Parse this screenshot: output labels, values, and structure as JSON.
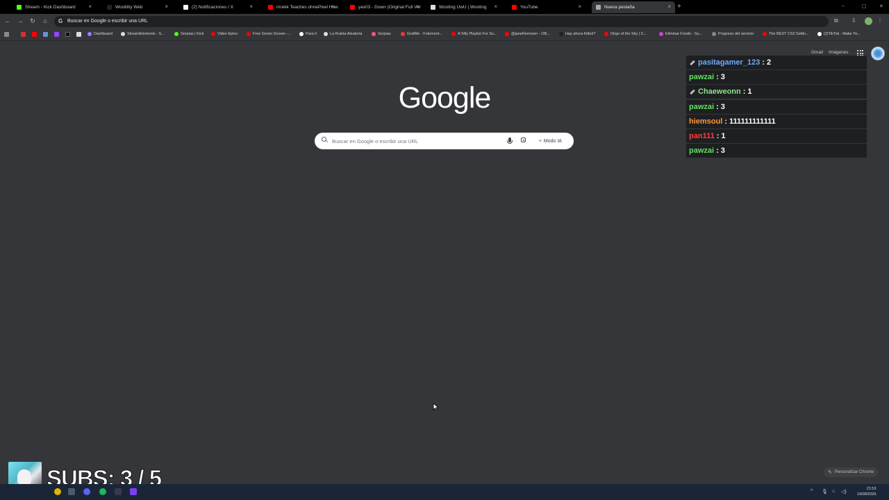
{
  "tabs": [
    {
      "title": "Stream - Kick Dashboard",
      "favicon_color": "#53fc18",
      "active": false
    },
    {
      "title": "Wootility Web",
      "favicon_color": "#222222",
      "active": false
    },
    {
      "title": "(2) Notificaciones / X",
      "favicon_color": "#ffffff",
      "active": false
    },
    {
      "title": "mrekk Teaches ohnePixel How t",
      "favicon_color": "#ff0000",
      "active": false
    },
    {
      "title": "yax03 - Down (Original Full Ver",
      "favicon_color": "#ff0000",
      "active": false
    },
    {
      "title": "Wooting UwU | Wooting",
      "favicon_color": "#dddddd",
      "active": false
    },
    {
      "title": "YouTube",
      "favicon_color": "#ff0000",
      "active": false
    },
    {
      "title": "Nueva pestaña",
      "favicon_color": "#aaaaaa",
      "active": true
    }
  ],
  "new_tab_label": "+",
  "omnibox": {
    "text": "Buscar en Google o escribir una URL"
  },
  "bookmarks": [
    {
      "label": "",
      "color": "#9b7bff"
    },
    {
      "label": "Dashboard",
      "color": "#9b7bff"
    },
    {
      "label": "StreamElements - S...",
      "color": "#dddddd"
    },
    {
      "label": "Serpias | Kick",
      "color": "#53fc18"
    },
    {
      "label": "Video Epico",
      "color": "#ff0000"
    },
    {
      "label": "Free Green Screen -...",
      "color": "#ff0000"
    },
    {
      "label": "Para ti",
      "color": "#ffffff"
    },
    {
      "label": "La Ruleta Aleatoria",
      "color": "#dddddd"
    },
    {
      "label": "Serpias",
      "color": "#ff5577"
    },
    {
      "label": "GrafMe - Fotomont...",
      "color": "#ff3333"
    },
    {
      "label": "A Silly Playlist For Su...",
      "color": "#ff0000"
    },
    {
      "label": "@janeRemover - OB...",
      "color": "#ff0000"
    },
    {
      "label": "Hay ahora fútbol?",
      "color": "#222222"
    },
    {
      "label": "Dirge of the Sky | C...",
      "color": "#ff0000"
    },
    {
      "label": "Eliminar Fondo - Su...",
      "color": "#cc44cc"
    },
    {
      "label": "Progreso del servicio",
      "color": "#888888"
    },
    {
      "label": "The BEST CS2 Settin...",
      "color": "#ff0000"
    },
    {
      "label": "(2)TikTok - Make Yo...",
      "color": "#ffffff"
    }
  ],
  "google": {
    "gmail": "Gmail",
    "images": "Imágenes",
    "logo": "Google",
    "search_placeholder": "Buscar en Google o escribir una URL",
    "ai_mode": "Modo IA",
    "customize": "Personalizar Chrome"
  },
  "chat": [
    {
      "user": "pasitagamer_123",
      "message": "2",
      "color": "#6fa8ff",
      "badge": true
    },
    {
      "user": "pawzai",
      "message": "3",
      "color": "#5ce65c",
      "badge": false
    },
    {
      "user": "Chaeweonn",
      "message": "1",
      "color": "#8fe08f",
      "badge": true
    },
    {
      "user": "pawzai",
      "message": "3",
      "color": "#5ce65c",
      "badge": false
    },
    {
      "user": "hiemsoul",
      "message": "111111111111",
      "color": "#ff9933",
      "badge": false
    },
    {
      "user": "pan111",
      "message": "1",
      "color": "#ff3b3b",
      "badge": false
    },
    {
      "user": "pawzai",
      "message": "3",
      "color": "#5ce65c",
      "badge": false
    }
  ],
  "subs": {
    "text": "SUBS: 3 / 5",
    "current": 3,
    "goal": 5
  },
  "clock": {
    "time": "21:53",
    "date": "19/08/2026"
  }
}
